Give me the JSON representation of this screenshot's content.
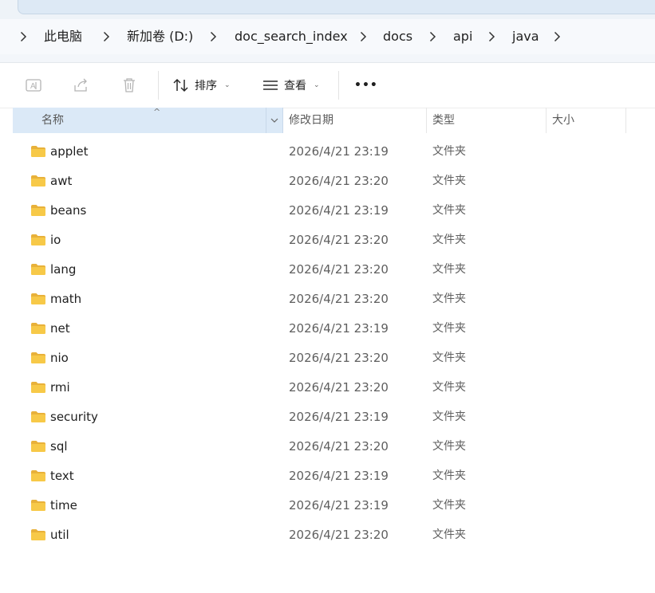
{
  "breadcrumb": {
    "items": [
      {
        "label": "此电脑"
      },
      {
        "label": "新加卷 (D:)"
      },
      {
        "label": "doc_search_index"
      },
      {
        "label": "docs"
      },
      {
        "label": "api"
      },
      {
        "label": "java"
      }
    ]
  },
  "toolbar": {
    "rename_icon": "rename-icon",
    "share_icon": "share-icon",
    "delete_icon": "trash-icon",
    "sort_label": "排序",
    "view_label": "查看",
    "more_label": "•••"
  },
  "columns": {
    "name": "名称",
    "modified": "修改日期",
    "type": "类型",
    "size": "大小"
  },
  "colors": {
    "header_selected_bg": "#dbe9f7",
    "folder_yellow": "#f7c948",
    "folder_dark": "#e8b13a"
  },
  "files": [
    {
      "name": "applet",
      "modified": "2026/4/21 23:19",
      "type": "文件夹"
    },
    {
      "name": "awt",
      "modified": "2026/4/21 23:20",
      "type": "文件夹"
    },
    {
      "name": "beans",
      "modified": "2026/4/21 23:19",
      "type": "文件夹"
    },
    {
      "name": "io",
      "modified": "2026/4/21 23:20",
      "type": "文件夹"
    },
    {
      "name": "lang",
      "modified": "2026/4/21 23:20",
      "type": "文件夹"
    },
    {
      "name": "math",
      "modified": "2026/4/21 23:20",
      "type": "文件夹"
    },
    {
      "name": "net",
      "modified": "2026/4/21 23:19",
      "type": "文件夹"
    },
    {
      "name": "nio",
      "modified": "2026/4/21 23:20",
      "type": "文件夹"
    },
    {
      "name": "rmi",
      "modified": "2026/4/21 23:20",
      "type": "文件夹"
    },
    {
      "name": "security",
      "modified": "2026/4/21 23:19",
      "type": "文件夹"
    },
    {
      "name": "sql",
      "modified": "2026/4/21 23:20",
      "type": "文件夹"
    },
    {
      "name": "text",
      "modified": "2026/4/21 23:19",
      "type": "文件夹"
    },
    {
      "name": "time",
      "modified": "2026/4/21 23:19",
      "type": "文件夹"
    },
    {
      "name": "util",
      "modified": "2026/4/21 23:20",
      "type": "文件夹"
    }
  ]
}
